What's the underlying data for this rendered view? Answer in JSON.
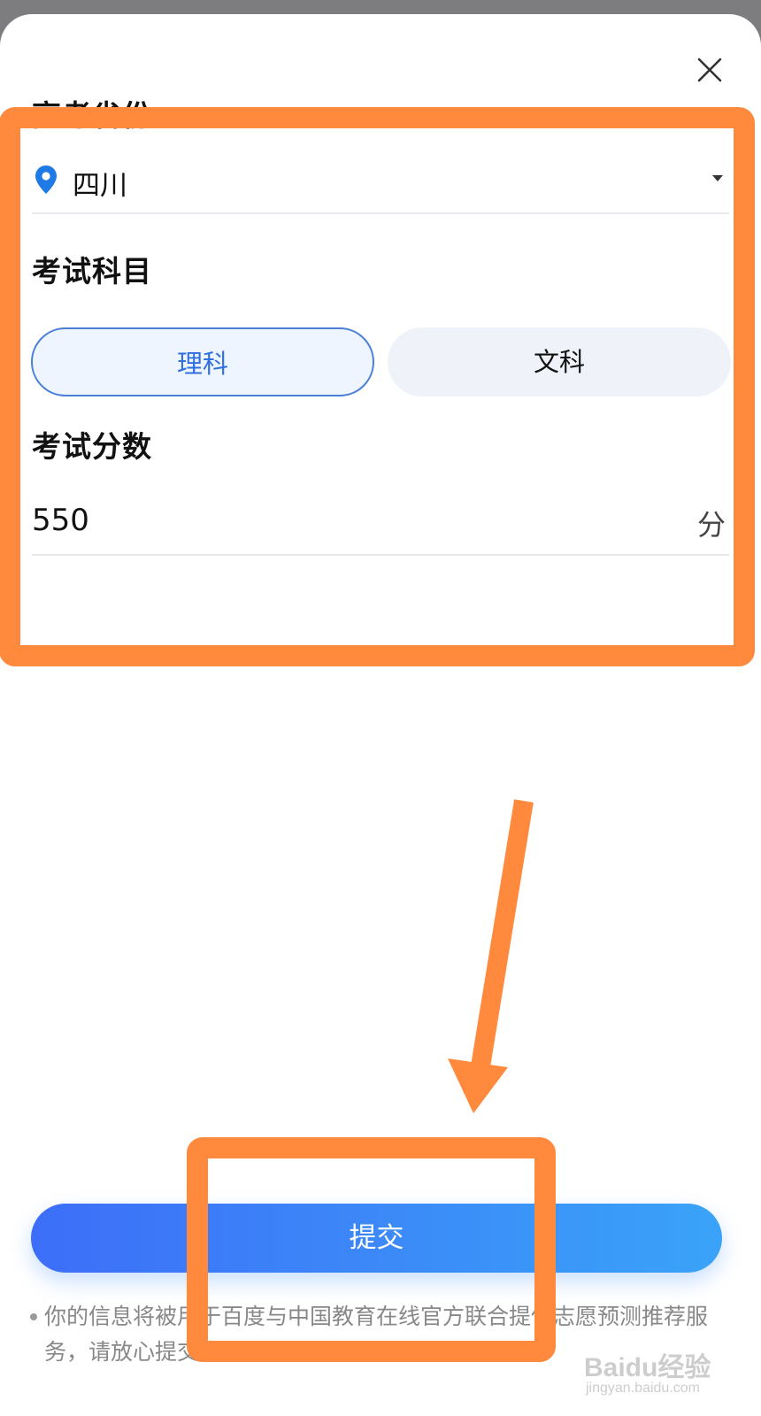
{
  "form": {
    "province_label": "高考省份",
    "province_value": "四川",
    "subject_label": "考试科目",
    "subject_options": [
      "理科",
      "文科"
    ],
    "selected_subject": "理科",
    "score_label": "考试分数",
    "score_value": "550",
    "score_unit": "分"
  },
  "submit_label": "提交",
  "note": "你的信息将被用于百度与中国教育在线官方联合提供志愿预测推荐服务，请放心提交。",
  "watermark": {
    "brand": "Baidu经验",
    "site": "jingyan.baidu.com"
  },
  "colors": {
    "accent": "#2f6fe0",
    "annotation": "#ff8a3d",
    "submit_start": "#3d6ef8",
    "submit_end": "#3aa3f8"
  },
  "icons": [
    "close-icon",
    "location-pin-icon",
    "dropdown-caret-icon"
  ]
}
